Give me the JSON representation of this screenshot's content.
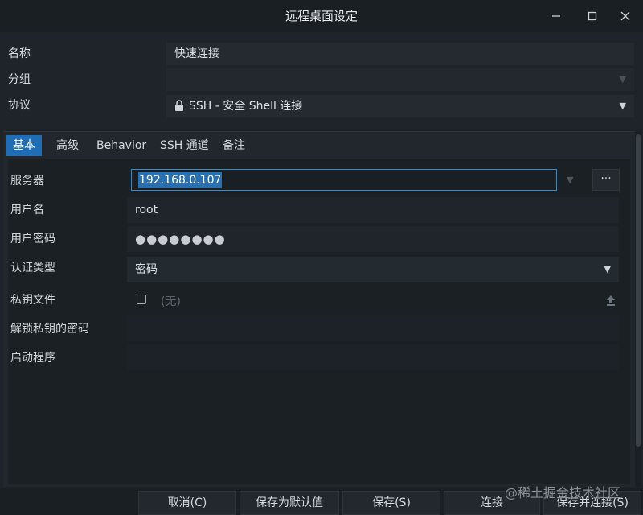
{
  "window": {
    "title": "远程桌面设定",
    "minimize_label": "—",
    "maximize_label": "☐",
    "close_label": "✕"
  },
  "form": {
    "name_label": "名称",
    "name_value": "快速连接",
    "group_label": "分组",
    "group_value": "",
    "protocol_label": "协议",
    "protocol_value": "SSH - 安全 Shell 连接"
  },
  "tabs": [
    {
      "label": "基本",
      "active": true
    },
    {
      "label": "高级",
      "active": false
    },
    {
      "label": "Behavior",
      "active": false
    },
    {
      "label": "SSH 通道",
      "active": false
    },
    {
      "label": "备注",
      "active": false
    }
  ],
  "basic": {
    "server_label": "服务器",
    "server_value": "192.168.0.107",
    "server_more": "···",
    "username_label": "用户名",
    "username_value": "root",
    "password_label": "用户密码",
    "password_value": "●●●●●●●●",
    "auth_label": "认证类型",
    "auth_value": "密码",
    "key_label": "私钥文件",
    "key_value": "(无)",
    "key_checked": false,
    "unlock_label": "解锁私钥的密码",
    "unlock_value": "",
    "startup_label": "启动程序",
    "startup_value": ""
  },
  "buttons": {
    "cancel": "取消(C)",
    "save_default": "保存为默认值",
    "save": "保存(S)",
    "connect": "连接",
    "save_connect": "保存并连接(S)"
  },
  "watermark": "@稀土掘金技术社区",
  "colors": {
    "accent": "#1f6eb5",
    "background": "#1d2328",
    "focus_border": "#3a89c9"
  }
}
